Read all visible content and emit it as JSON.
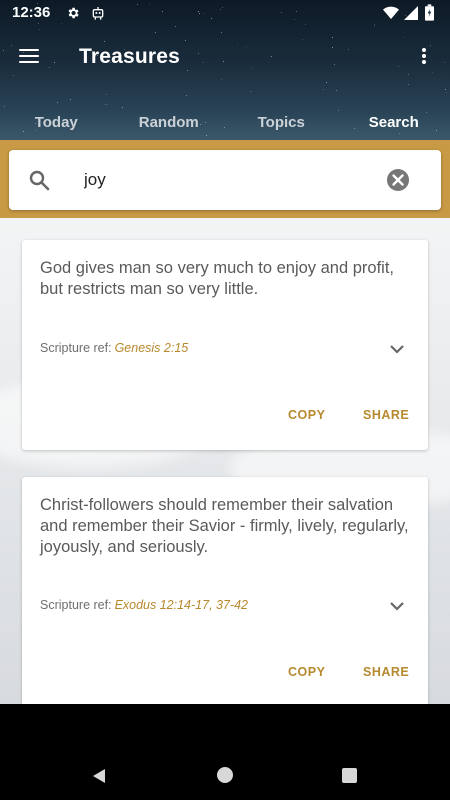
{
  "status_bar": {
    "time": "12:36",
    "icons": [
      "gear-icon",
      "robot-icon",
      "wifi-icon",
      "signal-icon",
      "battery-icon"
    ]
  },
  "toolbar": {
    "title": "Treasures",
    "menu_icon": "hamburger-menu-icon",
    "overflow_icon": "more-vert-icon"
  },
  "tabs": [
    {
      "label": "Today",
      "active": false
    },
    {
      "label": "Random",
      "active": false
    },
    {
      "label": "Topics",
      "active": false
    },
    {
      "label": "Search",
      "active": true
    }
  ],
  "search": {
    "value": "joy",
    "search_icon": "search-icon",
    "clear_icon": "clear-circle-icon"
  },
  "results": [
    {
      "quote": "God gives man so very much to enjoy and profit, but restricts man so very little.",
      "ref_label": "Scripture ref:",
      "ref_value": "Genesis 2:15",
      "copy_label": "COPY",
      "share_label": "SHARE"
    },
    {
      "quote": "Christ-followers should remember their salvation and remember their Savior - firmly, lively, regularly, joyously, and seriously.",
      "ref_label": "Scripture ref:",
      "ref_value": "Exodus 12:14-17, 37-42",
      "copy_label": "COPY",
      "share_label": "SHARE"
    }
  ],
  "colors": {
    "accent_gold": "#c89a45",
    "link_gold": "#b7892e",
    "header_dark": "#1a2c3c"
  }
}
